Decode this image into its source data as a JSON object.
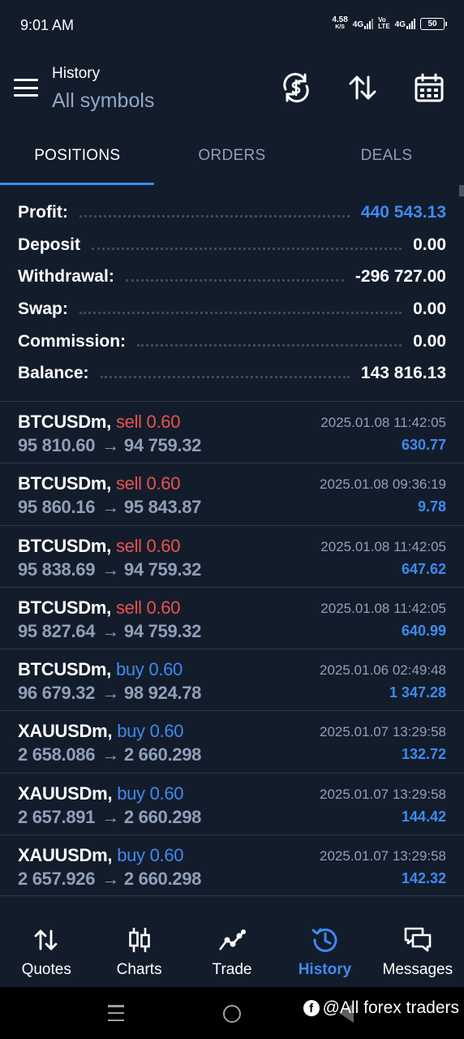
{
  "status_bar": {
    "time": "9:01 AM",
    "speed_value": "4.58",
    "speed_unit": "K/S",
    "net1": "4G",
    "volte_top": "Vo",
    "volte_bottom": "LTE",
    "net2": "4G",
    "battery": "50"
  },
  "header": {
    "title": "History",
    "subtitle": "All symbols",
    "icons": [
      "currency-refresh-icon",
      "sort-icon",
      "calendar-icon"
    ]
  },
  "tabs": [
    {
      "label": "POSITIONS",
      "active": true
    },
    {
      "label": "ORDERS",
      "active": false
    },
    {
      "label": "DEALS",
      "active": false
    }
  ],
  "summary": [
    {
      "label": "Profit:",
      "value": "440 543.13",
      "highlight": true
    },
    {
      "label": "Deposit",
      "value": "0.00",
      "highlight": false
    },
    {
      "label": "Withdrawal:",
      "value": "-296 727.00",
      "highlight": false
    },
    {
      "label": "Swap:",
      "value": "0.00",
      "highlight": false
    },
    {
      "label": "Commission:",
      "value": "0.00",
      "highlight": false
    },
    {
      "label": "Balance:",
      "value": "143 816.13",
      "highlight": false
    }
  ],
  "positions": [
    {
      "symbol": "BTCUSDm,",
      "side": "sell 0.60",
      "side_type": "sell",
      "open": "95 810.60",
      "arrow": "→",
      "close": "94 759.32",
      "date": "2025.01.08 11:42:05",
      "profit": "630.77"
    },
    {
      "symbol": "BTCUSDm,",
      "side": "sell 0.60",
      "side_type": "sell",
      "open": "95 860.16",
      "arrow": "→",
      "close": "95 843.87",
      "date": "2025.01.08 09:36:19",
      "profit": "9.78"
    },
    {
      "symbol": "BTCUSDm,",
      "side": "sell 0.60",
      "side_type": "sell",
      "open": "95 838.69",
      "arrow": "→",
      "close": "94 759.32",
      "date": "2025.01.08 11:42:05",
      "profit": "647.62"
    },
    {
      "symbol": "BTCUSDm,",
      "side": "sell 0.60",
      "side_type": "sell",
      "open": "95 827.64",
      "arrow": "→",
      "close": "94 759.32",
      "date": "2025.01.08 11:42:05",
      "profit": "640.99"
    },
    {
      "symbol": "BTCUSDm,",
      "side": "buy 0.60",
      "side_type": "buy",
      "open": "96 679.32",
      "arrow": "→",
      "close": "98 924.78",
      "date": "2025.01.06 02:49:48",
      "profit": "1 347.28"
    },
    {
      "symbol": "XAUUSDm,",
      "side": "buy 0.60",
      "side_type": "buy",
      "open": "2 658.086",
      "arrow": "→",
      "close": "2 660.298",
      "date": "2025.01.07 13:29:58",
      "profit": "132.72"
    },
    {
      "symbol": "XAUUSDm,",
      "side": "buy 0.60",
      "side_type": "buy",
      "open": "2 657.891",
      "arrow": "→",
      "close": "2 660.298",
      "date": "2025.01.07 13:29:58",
      "profit": "144.42"
    },
    {
      "symbol": "XAUUSDm,",
      "side": "buy 0.60",
      "side_type": "buy",
      "open": "2 657.926",
      "arrow": "→",
      "close": "2 660.298",
      "date": "2025.01.07 13:29:58",
      "profit": "142.32"
    }
  ],
  "bottom_nav": [
    {
      "label": "Quotes",
      "icon": "quotes-arrows-icon",
      "active": false
    },
    {
      "label": "Charts",
      "icon": "candlestick-chart-icon",
      "active": false
    },
    {
      "label": "Trade",
      "icon": "trade-line-icon",
      "active": false
    },
    {
      "label": "History",
      "icon": "history-clock-icon",
      "active": true
    },
    {
      "label": "Messages",
      "icon": "messages-icon",
      "active": false
    }
  ],
  "watermark": {
    "text": "@All forex traders",
    "icon": "facebook-icon"
  },
  "colors": {
    "background": "#131c2b",
    "accent": "#3d8bef",
    "sell": "#e8534e",
    "muted": "#8ea0b8"
  }
}
